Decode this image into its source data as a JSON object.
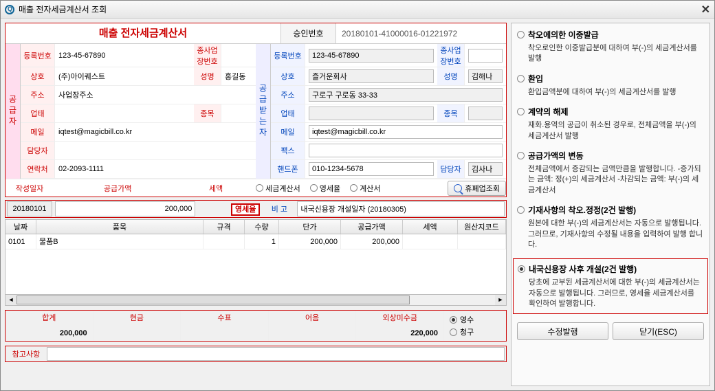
{
  "window_title": "매출 전자세금계산서 조회",
  "main_title": "매출 전자세금계산서",
  "approval": {
    "label": "승인번호",
    "value": "20180101-41000016-01221972"
  },
  "supplier": {
    "side_label": "공급자",
    "reg_label": "등록번호",
    "reg": "123-45-67890",
    "sub_label": "종사업장번호",
    "sub": "",
    "name_label": "상호",
    "name": "(주)아이퀘스트",
    "ceo_label": "성명",
    "ceo": "홍길동",
    "addr_label": "주소",
    "addr": "사업장주소",
    "biz_label": "업태",
    "biz": "",
    "item_label": "종목",
    "item": "",
    "mail_label": "메일",
    "mail": "iqtest@magicbill.co.kr",
    "mgr_label": "담당자",
    "mgr": "",
    "tel_label": "연락처",
    "tel": "02-2093-1111"
  },
  "buyer": {
    "side_label": "공급받는자",
    "reg_label": "등록번호",
    "reg": "123-45-67890",
    "sub_label": "종사업장번호",
    "sub": "",
    "name_label": "상호",
    "name": "즐거운회사",
    "ceo_label": "성명",
    "ceo": "김해나",
    "addr_label": "주소",
    "addr": "구로구 구로동 33-33",
    "biz_label": "업태",
    "biz": "",
    "item_label": "종목",
    "item": "",
    "mail_label": "메일",
    "mail": "iqtest@magicbill.co.kr",
    "fax_label": "팩스",
    "fax": "",
    "cell_label": "핸드폰",
    "cell": "010-1234-5678",
    "mgr_label": "담당자",
    "mgr": "김사나"
  },
  "doc": {
    "date_label": "작성일자",
    "supply_label": "공급가액",
    "tax_label": "세액",
    "r1": "세금계산서",
    "r2": "영세율",
    "r3": "계산서",
    "lookup": "휴폐업조회",
    "date": "20180101",
    "supply": "200,000",
    "tax_tag": "영세율",
    "remark_label": "비 고",
    "remark": "내국신용장 개설일자 (20180305)"
  },
  "grid": {
    "h_date": "날짜",
    "h_item": "품목",
    "h_spec": "규격",
    "h_qty": "수량",
    "h_price": "단가",
    "h_supply": "공급가액",
    "h_tax": "세액",
    "h_origin": "원산지코드",
    "rows": [
      {
        "date": "0101",
        "item": "물품B",
        "spec": "",
        "qty": "1",
        "price": "200,000",
        "supply": "200,000",
        "tax": "",
        "origin": ""
      }
    ]
  },
  "sum": {
    "h_total": "합계",
    "h_cash": "현금",
    "h_check": "수표",
    "h_note": "어음",
    "h_credit": "외상미수금",
    "total": "200,000",
    "cash": "",
    "check": "",
    "note": "",
    "credit": "220,000",
    "r_receipt": "영수",
    "r_charge": "청구"
  },
  "note": {
    "label": "참고사항",
    "value": ""
  },
  "options": [
    {
      "title": "착오에의한 이중발급",
      "desc": "착오로인한 이중발급분에 대하여 부(-)의 세금계산서를 발행"
    },
    {
      "title": "환입",
      "desc": "환입금액분에 대하여 부(-)의 세금계산서를 발행"
    },
    {
      "title": "계약의 해제",
      "desc": "재화.용역의 공급이 취소된 경우로, 전체금액을 부(-)의 세금계산서 발행"
    },
    {
      "title": "공급가액의 변동",
      "desc": "전체금액에서 증감되는 금액만큼을 발행합니다.\n-증가되는 금액: 정(+)의 세금계산서\n-차감되는 금액: 부(-)의 세금계산서"
    },
    {
      "title": "기재사항의 착오.정정(2건 발행)",
      "desc": "원본에 대한 부(-)의 세금계산서는 자동으로 발행됩니다. 그러므로, 기재사항의 수정될 내용을 입력하여 발행 합니다."
    },
    {
      "title": "내국신용장 사후 개설(2건 발행)",
      "desc": "당초에 교부된 세금계산서에 대한 부(-)의 세금계산서는 자동으로 발행됩니다. 그러므로, 영세율 세금계산서를 확인하여 발행합니다.",
      "selected": true
    }
  ],
  "buttons": {
    "issue": "수정발행",
    "close": "닫기(ESC)"
  }
}
